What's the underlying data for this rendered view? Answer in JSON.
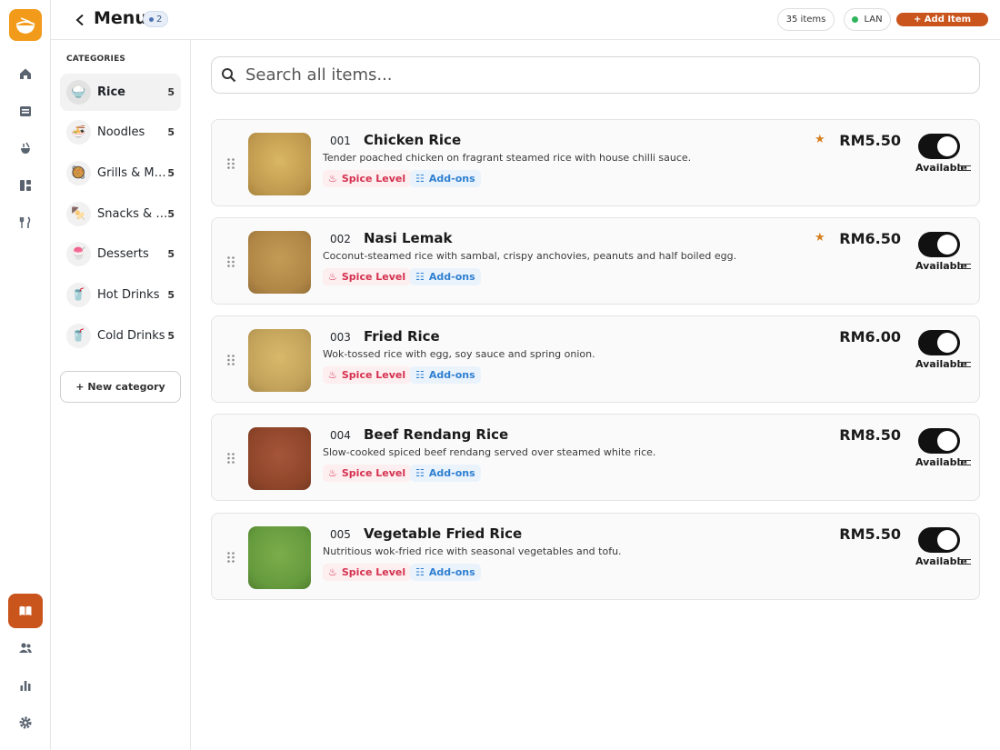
{
  "app": {
    "logo_icon": "bowl-logo-icon",
    "accent": "#c9541c"
  },
  "rail": {
    "top": [
      "home-icon",
      "store-icon",
      "kitchen-icon",
      "dashboard-icon",
      "utensils-icon"
    ],
    "bottom": [
      "menu-book-icon",
      "users-icon",
      "bar-chart-icon",
      "gear-icon"
    ]
  },
  "header": {
    "title": "Menu",
    "badge": "2",
    "items_count": "35 items",
    "connection": "LAN",
    "add_item_label": "+ Add Item"
  },
  "categories": {
    "heading": "CATEGORIES",
    "items": [
      {
        "name": "Rice",
        "count": "5",
        "icon": "🍚"
      },
      {
        "name": "Noodles",
        "count": "5",
        "icon": "🍜"
      },
      {
        "name": "Grills & Mains",
        "count": "5",
        "icon": "🥘"
      },
      {
        "name": "Snacks & Sides",
        "count": "5",
        "icon": "🍢"
      },
      {
        "name": "Desserts",
        "count": "5",
        "icon": "🍧"
      },
      {
        "name": "Hot Drinks",
        "count": "5",
        "icon": "🥤"
      },
      {
        "name": "Cold Drinks",
        "count": "5",
        "icon": "🥤"
      }
    ],
    "new_category_label": "+ New category"
  },
  "search": {
    "placeholder": "Search all items..."
  },
  "items": [
    {
      "code": "001",
      "name": "Chicken Rice",
      "description": "Tender poached chicken on fragrant steamed rice with house chilli sauce.",
      "spice_label": "Spice Level",
      "addons_label": "Add-ons",
      "price": "RM5.50",
      "starred": true,
      "status": "Available",
      "thumb_color": "#c9a75a"
    },
    {
      "code": "002",
      "name": "Nasi Lemak",
      "description": "Coconut-steamed rice with sambal, crispy anchovies, peanuts and half boiled egg.",
      "spice_label": "Spice Level",
      "addons_label": "Add-ons",
      "price": "RM6.50",
      "starred": true,
      "status": "Available",
      "thumb_color": "#b58c4a"
    },
    {
      "code": "003",
      "name": "Fried Rice",
      "description": "Wok-tossed rice with egg, soy sauce and spring onion.",
      "spice_label": "Spice Level",
      "addons_label": "Add-ons",
      "price": "RM6.00",
      "starred": false,
      "status": "Available",
      "thumb_color": "#c6a860"
    },
    {
      "code": "004",
      "name": "Beef Rendang Rice",
      "description": "Slow-cooked spiced beef rendang served over steamed white rice.",
      "spice_label": "Spice Level",
      "addons_label": "Add-ons",
      "price": "RM8.50",
      "starred": false,
      "status": "Available",
      "thumb_color": "#93492b"
    },
    {
      "code": "005",
      "name": "Vegetable Fried Rice",
      "description": "Nutritious wok-fried rice with seasonal vegetables and tofu.",
      "spice_label": "Spice Level",
      "addons_label": "Add-ons",
      "price": "RM5.50",
      "starred": false,
      "status": "Available",
      "thumb_color": "#6a9a3f"
    }
  ]
}
